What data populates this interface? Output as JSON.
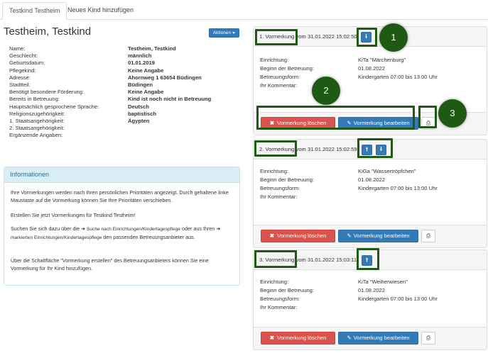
{
  "tabs": [
    {
      "label": "Testkind Testheim",
      "active": true
    },
    {
      "label": "Neues Kind hinzufügen",
      "active": false
    }
  ],
  "child": {
    "title": "Testheim, Testkind",
    "actions_label": "Aktionen"
  },
  "details": [
    {
      "label": "Name:",
      "value": "Testheim, Testkind"
    },
    {
      "label": "Geschlecht:",
      "value": "männlich"
    },
    {
      "label": "Geburtsdatum:",
      "value": "01.01.2019"
    },
    {
      "label": "Pflegekind:",
      "value": "Keine Angabe"
    },
    {
      "label": "Adresse:",
      "value": "Ahornweg 1 63654 Büdingen"
    },
    {
      "label": "Stadtteil:",
      "value": "Büdingen"
    },
    {
      "label": "Benötigt besondere Förderung:",
      "value": "Keine Angabe"
    },
    {
      "label": "Bereits in Betreuung:",
      "value": "Kind ist noch nicht in Betreuung"
    },
    {
      "label": "Hauptsächlich gesprochene Sprache:",
      "value": "Deutsch"
    },
    {
      "label": "Religionszugehörigkeit:",
      "value": "baptistisch"
    },
    {
      "label": "1. Staatsangehörigkeit:",
      "value": "Ägypten"
    },
    {
      "label": "2. Staatsangehörigkeit:",
      "value": ""
    },
    {
      "label": "Ergänzende Angaben:",
      "value": ""
    }
  ],
  "info": {
    "heading": "Informationen",
    "p1": "Ihre Vormerkungen werden nach Ihren persönlichen Prioritäten angezeigt. Durch gehaltene linke Maustaste auf die Vormerkung können Sie Ihre Prioritäten verschieben.",
    "p2": "Erstellen Sie jetzt Vormerkungen für Testkind Testheim!",
    "p3_a": "Suchen Sie sich dazu über die",
    "p3_link1": "Suche nach Einrichtungen/Kindertagespflege",
    "p3_b": "oder aus Ihren",
    "p3_link2": "markierten Einrichtungen/Kindertagespflege",
    "p3_c": "den passenden Betreuungsanbieter aus.",
    "p4": "Über die Schaltfläche \"Vormerkung erstellen\" des Betreuungsanbieters können Sie eine Vormerkung für Ihr Kind hinzufügen."
  },
  "vormerkung_labels": {
    "einrichtung": "Einrichtung:",
    "beginn": "Beginn der Betreuung:",
    "form": "Betreuungsform:",
    "kommentar": "Ihr Kommentar:",
    "delete": "Vormerkung löschen",
    "edit": "Vormerkung bearbeiten"
  },
  "vormerkungen": [
    {
      "title_num": "1. Vormerkung",
      "title_rest": "vom 31.01.2022 15:02:50",
      "einrichtung": "KiTa \"Märchenburg\"",
      "beginn": "01.08.2022",
      "form": "Kindergarten 07:00 bis 13:00 Uhr"
    },
    {
      "title_num": "2. Vormerkung",
      "title_rest": "vom 31.01.2022 15:02:59",
      "einrichtung": "KiGa \"Wassertröpfchen\"",
      "beginn": "01.08.2022",
      "form": "Kindergarten 07:00 bis 13:00 Uhr"
    },
    {
      "title_num": "3. Vormerkung",
      "title_rest": "vom 31.01.2022 15:03:11",
      "einrichtung": "KiTa \"Weiherwiesen\"",
      "beginn": "01.08.2022",
      "form": "Kindergarten 07:00 bis 13:00 Uhr"
    }
  ],
  "badges": [
    "1",
    "2",
    "3"
  ],
  "colors": {
    "primary": "#337ab7",
    "danger": "#d9534f",
    "annotation": "#1f5a14",
    "info_bg": "#d9edf7"
  }
}
